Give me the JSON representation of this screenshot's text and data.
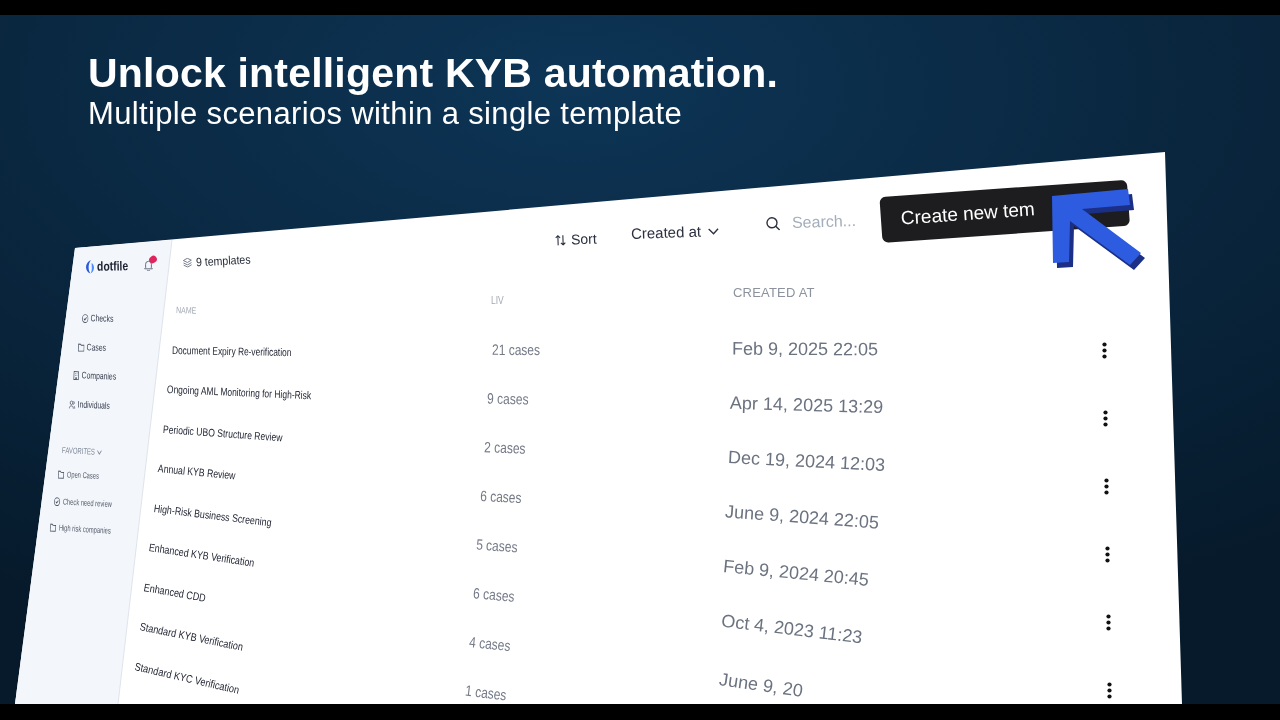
{
  "hero": {
    "title": "Unlock intelligent KYB automation.",
    "subtitle": "Multiple scenarios within a single template"
  },
  "sidebar": {
    "logo": "dotfile",
    "notifications_unread": true,
    "nav": [
      "Checks",
      "Cases",
      "Companies",
      "Individuals"
    ],
    "favorites": {
      "title": "FAVORITES",
      "expanded": true,
      "items": [
        "Open Cases",
        "Check need review",
        "High risk companies"
      ]
    }
  },
  "toolbar": {
    "count": "9 templates",
    "sort": "Sort",
    "sort_by": "Created at",
    "search": {
      "placeholder": "Search..."
    },
    "create_button": "Create new tem"
  },
  "table": {
    "columns": [
      "NAME",
      "LIV",
      "CREATED AT"
    ],
    "rows": [
      {
        "name": "Document Expiry Re-verification",
        "cases": "21 cases",
        "created_at": "Feb 9, 2025 22:05",
        "menu": true
      },
      {
        "name": "Ongoing AML Monitoring for High-Risk",
        "cases": "9 cases",
        "created_at": "Apr 14, 2025 13:29",
        "menu": true
      },
      {
        "name": "Periodic UBO Structure Review",
        "cases": "2 cases",
        "created_at": "Dec 19, 2024 12:03",
        "menu": true
      },
      {
        "name": "Annual KYB Review",
        "cases": "6 cases",
        "created_at": "June 9, 2024 22:05",
        "menu": true
      },
      {
        "name": "High-Risk Business Screening",
        "cases": "5 cases",
        "created_at": "Feb 9, 2024 20:45",
        "menu": true
      },
      {
        "name": "Enhanced KYB Verification",
        "cases": "6 cases",
        "created_at": "Oct 4, 2023 11:23",
        "menu": true
      },
      {
        "name": "Enhanced CDD",
        "cases": "4 cases",
        "created_at": "June 9, 20"
      },
      {
        "name": "Standard KYB Verification",
        "cases": "1 cases"
      },
      {
        "name": "Standard KYC Verification"
      }
    ]
  }
}
